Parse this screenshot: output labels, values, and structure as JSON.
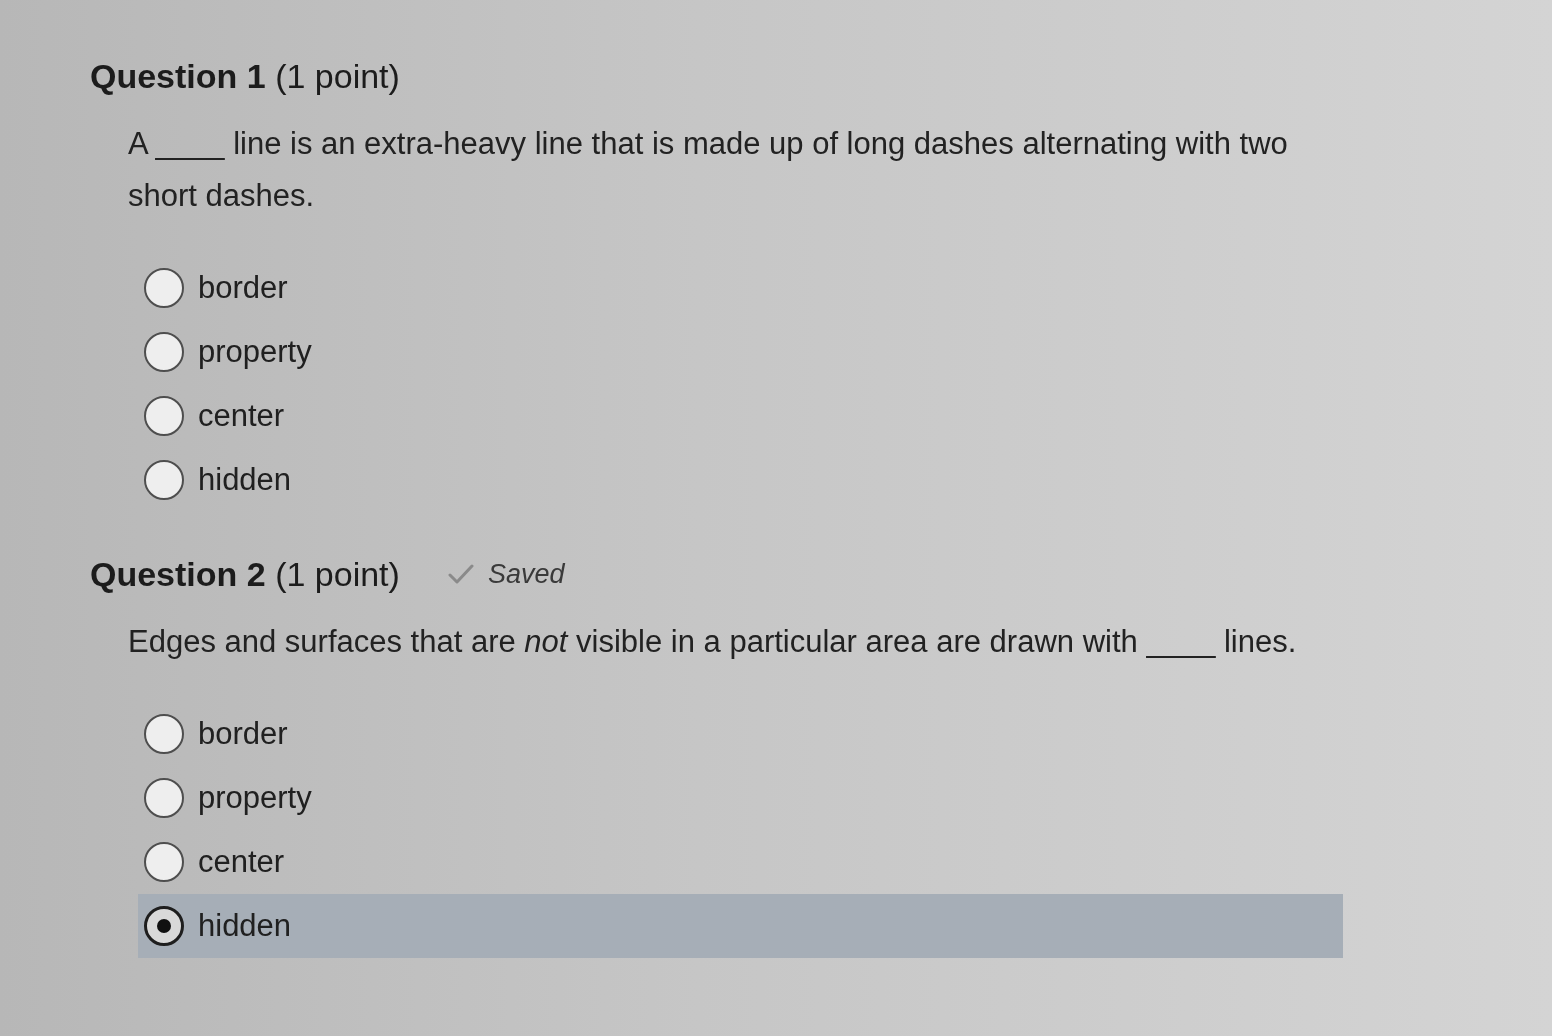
{
  "questions": [
    {
      "title": "Question 1",
      "points": "(1 point)",
      "prompt": "A ____ line is an extra-heavy line that is made up of long dashes alternating with two short dashes.",
      "options": [
        {
          "label": "border",
          "selected": false
        },
        {
          "label": "property",
          "selected": false
        },
        {
          "label": "center",
          "selected": false
        },
        {
          "label": "hidden",
          "selected": false
        }
      ]
    },
    {
      "title": "Question 2",
      "points": "(1 point)",
      "status": "Saved",
      "prompt": "Edges and surfaces that are *not* visible in a particular area are drawn with ____ lines.",
      "options": [
        {
          "label": "border",
          "selected": false
        },
        {
          "label": "property",
          "selected": false
        },
        {
          "label": "center",
          "selected": false
        },
        {
          "label": "hidden",
          "selected": true
        }
      ]
    }
  ]
}
